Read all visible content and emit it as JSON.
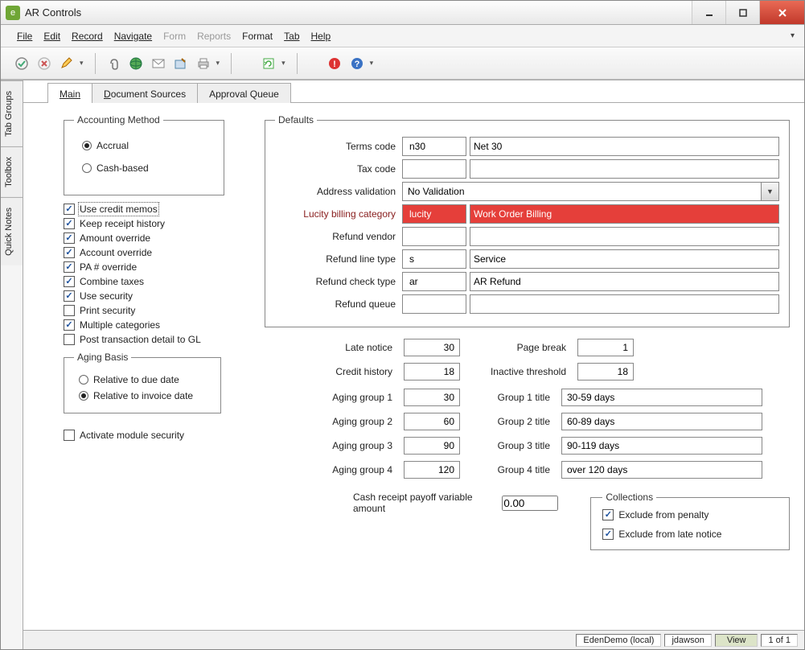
{
  "window": {
    "title": "AR Controls"
  },
  "menu": {
    "file": "File",
    "edit": "Edit",
    "record": "Record",
    "navigate": "Navigate",
    "form": "Form",
    "reports": "Reports",
    "format": "Format",
    "tab": "Tab",
    "help": "Help"
  },
  "side_tabs": {
    "tab_groups": "Tab Groups",
    "toolbox": "Toolbox",
    "quick_notes": "Quick Notes"
  },
  "page_tabs": {
    "main": "Main",
    "doc_sources": "Document Sources",
    "approval_queue": "Approval Queue"
  },
  "accounting_method": {
    "legend": "Accounting Method",
    "accrual": "Accrual",
    "cash_based": "Cash-based"
  },
  "checkboxes": {
    "use_credit_memos": {
      "label": "Use credit memos",
      "checked": true
    },
    "keep_receipt_history": {
      "label": "Keep receipt history",
      "checked": true
    },
    "amount_override": {
      "label": "Amount override",
      "checked": true
    },
    "account_override": {
      "label": "Account override",
      "checked": true
    },
    "pa_override": {
      "label": "PA # override",
      "checked": true
    },
    "combine_taxes": {
      "label": "Combine taxes",
      "checked": true
    },
    "use_security": {
      "label": "Use security",
      "checked": true
    },
    "print_security": {
      "label": "Print security",
      "checked": false
    },
    "multiple_categories": {
      "label": "Multiple categories",
      "checked": true
    },
    "post_transaction_detail": {
      "label": "Post transaction detail to GL",
      "checked": false
    }
  },
  "aging_basis": {
    "legend": "Aging Basis",
    "relative_due": "Relative to due date",
    "relative_invoice": "Relative to invoice date"
  },
  "activate_module_security": "Activate module security",
  "defaults": {
    "legend": "Defaults",
    "terms_code": {
      "label": "Terms code",
      "code": "n30",
      "desc": "Net 30"
    },
    "tax_code": {
      "label": "Tax code",
      "code": "",
      "desc": ""
    },
    "address_validation": {
      "label": "Address validation",
      "value": "No Validation"
    },
    "lucity_billing": {
      "label": "Lucity billing category",
      "code": "lucity",
      "desc": "Work Order Billing"
    },
    "refund_vendor": {
      "label": "Refund vendor",
      "code": "",
      "desc": ""
    },
    "refund_line_type": {
      "label": "Refund line type",
      "code": "s",
      "desc": "Service"
    },
    "refund_check_type": {
      "label": "Refund check type",
      "code": "ar",
      "desc": "AR Refund"
    },
    "refund_queue": {
      "label": "Refund queue",
      "code": "",
      "desc": ""
    }
  },
  "numbers": {
    "late_notice": {
      "label": "Late notice",
      "value": "30"
    },
    "page_break": {
      "label": "Page break",
      "value": "1"
    },
    "credit_history": {
      "label": "Credit history",
      "value": "18"
    },
    "inactive_threshold": {
      "label": "Inactive threshold",
      "value": "18"
    }
  },
  "aging_groups": {
    "g1": {
      "label": "Aging group 1",
      "value": "30",
      "title_label": "Group 1 title",
      "title": "30-59 days"
    },
    "g2": {
      "label": "Aging group 2",
      "value": "60",
      "title_label": "Group 2 title",
      "title": "60-89 days"
    },
    "g3": {
      "label": "Aging group 3",
      "value": "90",
      "title_label": "Group 3 title",
      "title": "90-119 days"
    },
    "g4": {
      "label": "Aging group 4",
      "value": "120",
      "title_label": "Group 4 title",
      "title": "over 120 days"
    }
  },
  "cash_receipt": {
    "label": "Cash receipt payoff variable amount",
    "value": "0.00"
  },
  "collections": {
    "legend": "Collections",
    "exclude_penalty": "Exclude from penalty",
    "exclude_late_notice": "Exclude from late notice"
  },
  "status": {
    "db": "EdenDemo (local)",
    "user": "jdawson",
    "mode": "View",
    "record": "1 of 1"
  }
}
